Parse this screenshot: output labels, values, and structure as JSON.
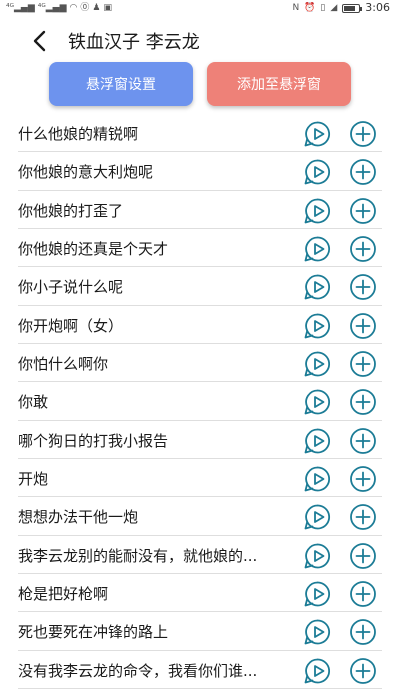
{
  "status_bar": {
    "left_glyphs": [
      "4G",
      "4G",
      "wifi",
      "0",
      "qq",
      "app"
    ],
    "right_glyphs": [
      "N",
      "alarm",
      "vibrate",
      "signal"
    ],
    "time": "3:06"
  },
  "header": {
    "title": "铁血汉子 李云龙"
  },
  "actions": {
    "float_settings_label": "悬浮窗设置",
    "add_to_float_label": "添加至悬浮窗"
  },
  "colors": {
    "accent_blue": "#6d93ee",
    "accent_red": "#ee8178",
    "icon_teal": "#1c7c96"
  },
  "items": [
    {
      "label": "什么他娘的精锐啊"
    },
    {
      "label": "你他娘的意大利炮呢"
    },
    {
      "label": "你他娘的打歪了"
    },
    {
      "label": "你他娘的还真是个天才"
    },
    {
      "label": "你小子说什么呢"
    },
    {
      "label": "你开炮啊（女）"
    },
    {
      "label": "你怕什么啊你"
    },
    {
      "label": "你敢"
    },
    {
      "label": "哪个狗日的打我小报告"
    },
    {
      "label": "开炮"
    },
    {
      "label": "想想办法干他一炮"
    },
    {
      "label": "我李云龙别的能耐没有，就他娘的..."
    },
    {
      "label": "枪是把好枪啊"
    },
    {
      "label": "死也要死在冲锋的路上"
    },
    {
      "label": "没有我李云龙的命令，我看你们谁..."
    }
  ]
}
